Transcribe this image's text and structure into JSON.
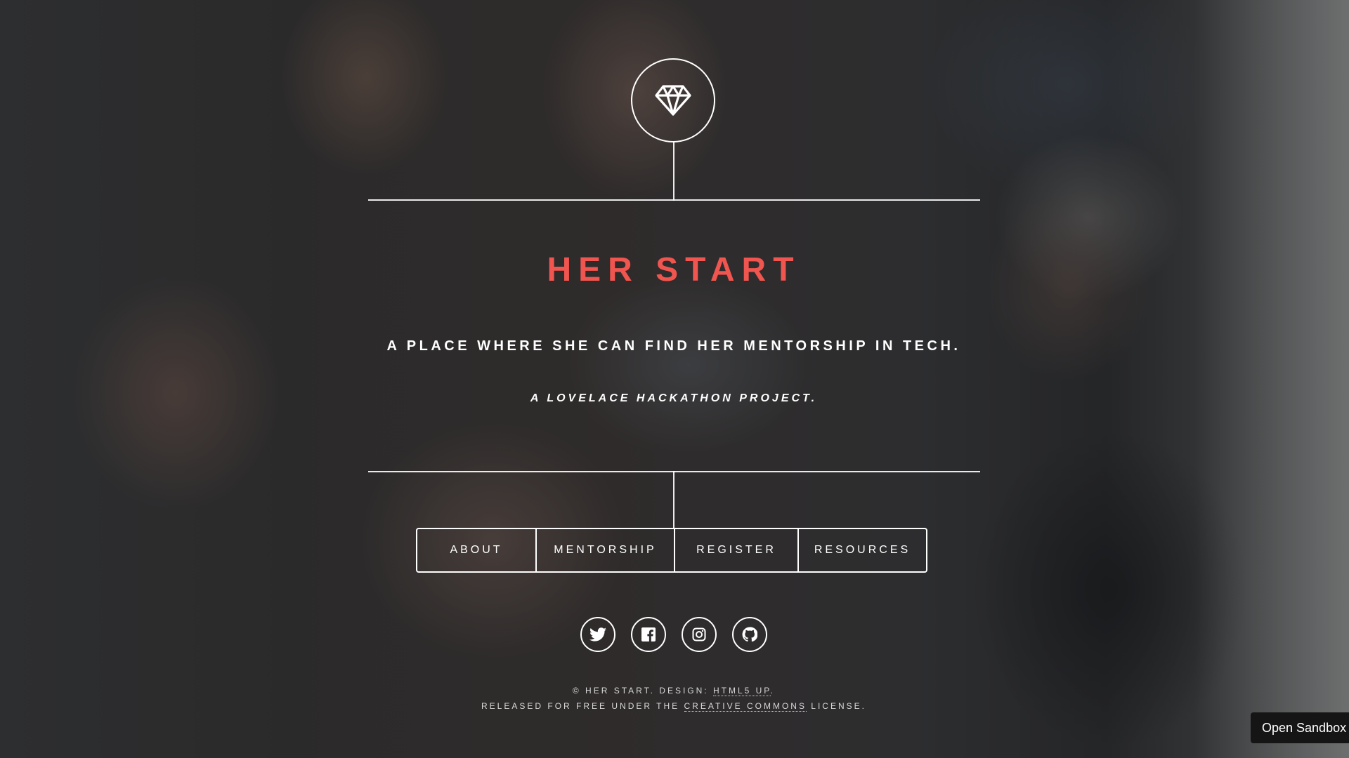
{
  "site": {
    "title": "HER START",
    "tagline": "A PLACE WHERE SHE CAN FIND HER MENTORSHIP IN TECH.",
    "subtagline": "A LOVELACE HACKATHON PROJECT.",
    "accent_color": "#f0554f",
    "logo_icon": "diamond-icon"
  },
  "nav": {
    "items": [
      {
        "label": "ABOUT"
      },
      {
        "label": "MENTORSHIP"
      },
      {
        "label": "REGISTER"
      },
      {
        "label": "RESOURCES"
      }
    ]
  },
  "social": {
    "icons": [
      "twitter-icon",
      "facebook-icon",
      "instagram-icon",
      "github-icon"
    ]
  },
  "footer": {
    "line1_prefix": "© HER START. DESIGN: ",
    "line1_link": "HTML5 UP",
    "line1_suffix": ".",
    "line2_prefix": "RELEASED FOR FREE UNDER THE ",
    "line2_link": "CREATIVE COMMONS",
    "line2_suffix": " LICENSE."
  },
  "sandbox": {
    "label": "Open Sandbox"
  }
}
